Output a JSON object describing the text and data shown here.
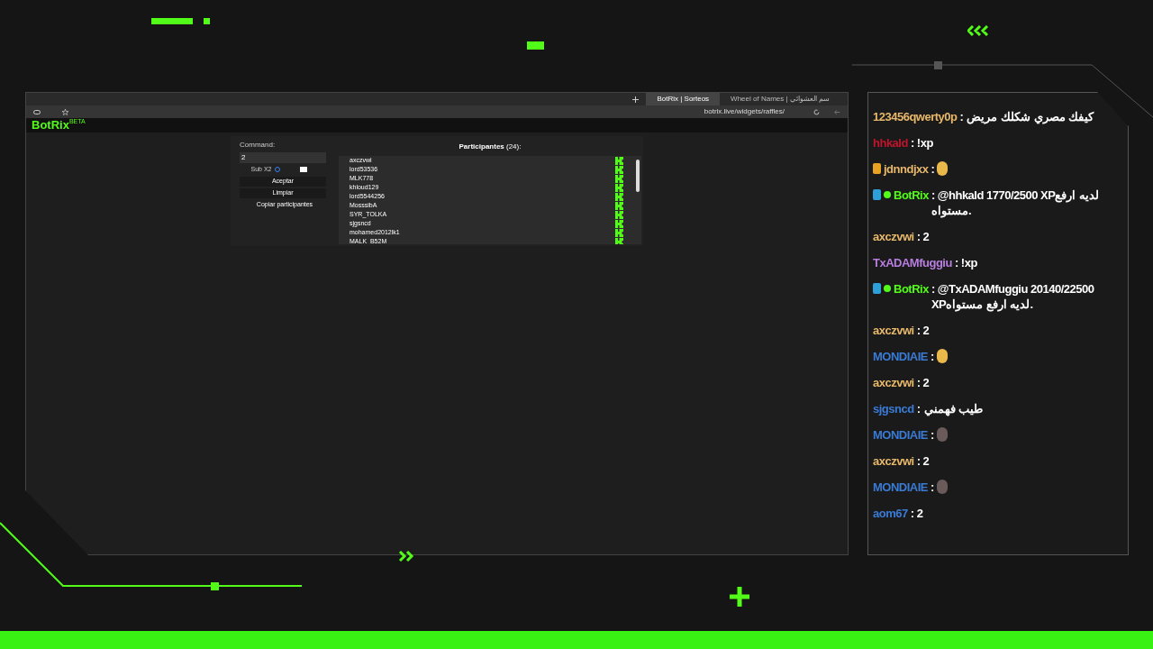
{
  "browser": {
    "tabs": [
      {
        "label": "BotRix | Sorteos",
        "selected": true
      },
      {
        "label": "Wheel of Names | سم العشوائي",
        "selected": false
      }
    ],
    "address": "botrix.live/widgets/raffles/"
  },
  "site": {
    "logo": "BotRix",
    "logo_badge": "BETA"
  },
  "raffle": {
    "command_label": "Command:",
    "command_value": "2",
    "sub_label": "Sub X2",
    "sub_checked": false,
    "buttons": [
      "Aceptar",
      "Limpiar",
      "Copiar participantes"
    ],
    "participants_title": "Participantes",
    "participants_count": "(24):",
    "participants": [
      "axczvwi",
      "lord53536",
      "MLK778",
      "khloud129",
      "lord5544256",
      "MosssibA",
      "SYR_TOLKA",
      "sjgsncd",
      "mohamed2012lk1",
      "MALK_B52M"
    ]
  },
  "chat": [
    {
      "user": "123456qwerty0p",
      "color": "#e8b86a",
      "kind": "text",
      "text": ": كيفك مصري شكلك مريض"
    },
    {
      "user": "hhkald",
      "color": "#c0142c",
      "kind": "text",
      "text": ": !xp"
    },
    {
      "user": "jdnndjxx",
      "color": "#e8b86a",
      "badges": [
        {
          "kind": "sub"
        }
      ],
      "kind": "emote",
      "text": ":"
    },
    {
      "user": "BotRix",
      "color": "#53fc18",
      "badges": [
        {
          "kind": "bot"
        },
        {
          "kind": "verified"
        }
      ],
      "kind": "text",
      "text": ": @hhkald 1770/2500 XPلديه ارفع مستواه."
    },
    {
      "user": "axczvwi",
      "color": "#e8b86a",
      "kind": "text",
      "text": ": 2"
    },
    {
      "user": "TxADAMfuggiu",
      "color": "#b87ee0",
      "kind": "text",
      "text": ": !xp"
    },
    {
      "user": "BotRix",
      "color": "#53fc18",
      "badges": [
        {
          "kind": "bot"
        },
        {
          "kind": "verified"
        }
      ],
      "kind": "text",
      "text": ": @TxADAMfuggiu 20140/22500 XPلديه ارفع مستواه."
    },
    {
      "user": "axczvwi",
      "color": "#e8b86a",
      "kind": "text",
      "text": ": 2"
    },
    {
      "user": "MONDIAIE",
      "color": "#3a7bd5",
      "kind": "emote",
      "text": ":"
    },
    {
      "user": "axczvwi",
      "color": "#e8b86a",
      "kind": "text",
      "text": ": 2"
    },
    {
      "user": "sjgsncd",
      "color": "#3a7bd5",
      "kind": "text",
      "text": ": طيب فهمني"
    },
    {
      "user": "MONDIAIE",
      "color": "#3a7bd5",
      "kind": "emote",
      "text": ":"
    },
    {
      "user": "axczvwi",
      "color": "#e8b86a",
      "kind": "text",
      "text": ": 2"
    },
    {
      "user": "MONDIAIE",
      "color": "#3a7bd5",
      "kind": "emote",
      "text": ":"
    },
    {
      "user": "aom67",
      "color": "#3a7bd5",
      "kind": "text",
      "text": ": 2"
    }
  ]
}
